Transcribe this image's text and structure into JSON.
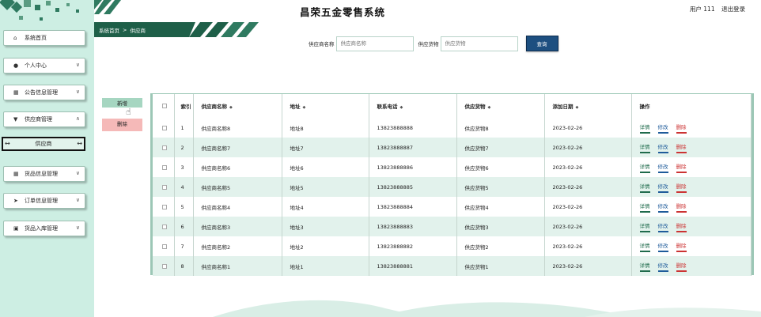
{
  "app": {
    "title": "昌荣五金零售系统"
  },
  "user": {
    "label": "用户 111",
    "logout": "退出登录"
  },
  "breadcrumb": {
    "home": "系统首页",
    "sep": ">",
    "current": "供应商"
  },
  "sidebar": {
    "items": [
      {
        "label": "系统首页",
        "icon": "home-icon",
        "glyph": "⌂",
        "chev": ""
      },
      {
        "label": "个人中心",
        "icon": "user-icon",
        "glyph": "●",
        "chev": "∨"
      },
      {
        "label": "公告信息管理",
        "icon": "grid-icon",
        "glyph": "▦",
        "chev": "∨"
      },
      {
        "label": "供应商管理",
        "icon": "supplier-icon",
        "glyph": "▼",
        "chev": "∧"
      },
      {
        "label": "货品信息管理",
        "icon": "grid-icon",
        "glyph": "▦",
        "chev": "∨"
      },
      {
        "label": "订单信息管理",
        "icon": "send-icon",
        "glyph": "➤",
        "chev": "∨"
      },
      {
        "label": "货品入库管理",
        "icon": "clipboard-icon",
        "glyph": "▣",
        "chev": "∨"
      }
    ],
    "submenu_label": "供应商"
  },
  "search": {
    "name_label": "供应商名称",
    "name_placeholder": "供应商名称",
    "goods_label": "供应货物",
    "goods_placeholder": "供应货物",
    "button": "查询"
  },
  "actions": {
    "add": "新增",
    "delete": "删除"
  },
  "table": {
    "headers": {
      "index": "索引",
      "name": "供应商名称",
      "address": "地址",
      "phone": "联系电话",
      "goods": "供应货物",
      "date": "添加日期",
      "ops": "操作"
    },
    "op_labels": {
      "detail": "详情",
      "edit": "修改",
      "delete": "删除"
    },
    "rows": [
      {
        "index": "1",
        "name": "供应商名称8",
        "address": "地址8",
        "phone": "13823888888",
        "goods": "供应货物8",
        "date": "2023-02-26"
      },
      {
        "index": "2",
        "name": "供应商名称7",
        "address": "地址7",
        "phone": "13823888887",
        "goods": "供应货物7",
        "date": "2023-02-26"
      },
      {
        "index": "3",
        "name": "供应商名称6",
        "address": "地址6",
        "phone": "13823888886",
        "goods": "供应货物6",
        "date": "2023-02-26"
      },
      {
        "index": "4",
        "name": "供应商名称5",
        "address": "地址5",
        "phone": "13823888885",
        "goods": "供应货物5",
        "date": "2023-02-26"
      },
      {
        "index": "5",
        "name": "供应商名称4",
        "address": "地址4",
        "phone": "13823888884",
        "goods": "供应货物4",
        "date": "2023-02-26"
      },
      {
        "index": "6",
        "name": "供应商名称3",
        "address": "地址3",
        "phone": "13823888883",
        "goods": "供应货物3",
        "date": "2023-02-26"
      },
      {
        "index": "7",
        "name": "供应商名称2",
        "address": "地址2",
        "phone": "13823888882",
        "goods": "供应货物2",
        "date": "2023-02-26"
      },
      {
        "index": "8",
        "name": "供应商名称1",
        "address": "地址1",
        "phone": "13823888881",
        "goods": "供应货物1",
        "date": "2023-02-26"
      }
    ]
  },
  "colors": {
    "sidebar_bg": "#cdeee3",
    "primary": "#1e5f48",
    "search_btn": "#1d4f80",
    "row_alt": "#e2f2ec"
  }
}
